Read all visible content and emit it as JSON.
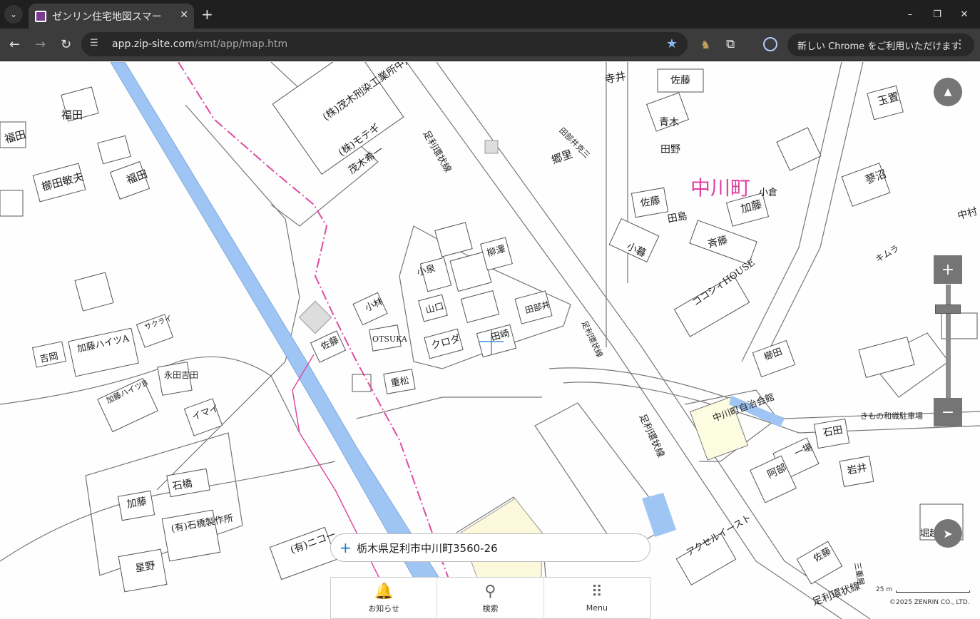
{
  "browser": {
    "tab_title": "ゼンリン住宅地図スマー",
    "url_host": "app.zip-site.com",
    "url_path": "/smt/app/map.htm",
    "update_chip": "新しい Chrome をご利用いただけます"
  },
  "map": {
    "town_name": "中川町",
    "labels": [
      {
        "name": "fukuda-1",
        "text": "福田"
      },
      {
        "name": "fukuda-2",
        "text": "福田"
      },
      {
        "name": "fukuda-3",
        "text": "福田"
      },
      {
        "name": "kushida-toshio",
        "text": "櫛田敏夫"
      },
      {
        "name": "mokita",
        "text": "(株)茂木刑染工業所中川工場"
      },
      {
        "name": "motegi",
        "text": "(株)モテギ"
      },
      {
        "name": "motegi-kiichi",
        "text": "茂木希一"
      },
      {
        "name": "ring-road-1",
        "text": "足利環状線"
      },
      {
        "name": "ring-road-2",
        "text": "足利環状線"
      },
      {
        "name": "ring-road-3",
        "text": "足利環状線"
      },
      {
        "name": "ring-road-4",
        "text": "足利環状線"
      },
      {
        "name": "terai",
        "text": "寺井"
      },
      {
        "name": "sato-1",
        "text": "佐藤"
      },
      {
        "name": "tamaoki",
        "text": "玉置"
      },
      {
        "name": "aoki",
        "text": "青木"
      },
      {
        "name": "tano",
        "text": "田野"
      },
      {
        "name": "tabei-katsumi",
        "text": "田部井克三"
      },
      {
        "name": "gori",
        "text": "郷里"
      },
      {
        "name": "kuranuma",
        "text": "蓼沼"
      },
      {
        "name": "oguraya",
        "text": "小倉"
      },
      {
        "name": "kato-1",
        "text": "加藤"
      },
      {
        "name": "sato-2",
        "text": "佐藤"
      },
      {
        "name": "tashima",
        "text": "田島"
      },
      {
        "name": "saito",
        "text": "斉藤"
      },
      {
        "name": "nakamura",
        "text": "中村"
      },
      {
        "name": "kogure",
        "text": "小暮"
      },
      {
        "name": "yanagisawa",
        "text": "柳澤"
      },
      {
        "name": "koizumi",
        "text": "小泉"
      },
      {
        "name": "kobayashi",
        "text": "小林"
      },
      {
        "name": "yamaguchi",
        "text": "山口"
      },
      {
        "name": "tabei",
        "text": "田部井"
      },
      {
        "name": "kimura",
        "text": "キムラ"
      },
      {
        "name": "kokoshii-house",
        "text": "ココシィHOUSE"
      },
      {
        "name": "kuroda",
        "text": "クロダ"
      },
      {
        "name": "tasaki",
        "text": "田崎"
      },
      {
        "name": "otsuka",
        "text": "OTSUKA"
      },
      {
        "name": "sato-3",
        "text": "佐藤"
      },
      {
        "name": "shigematsu",
        "text": "重松"
      },
      {
        "name": "yoshioka",
        "text": "吉岡"
      },
      {
        "name": "kato-heights-a",
        "text": "加藤ハイツA"
      },
      {
        "name": "kato-heights-b",
        "text": "加藤ハイツB"
      },
      {
        "name": "sakurai",
        "text": "サクライ"
      },
      {
        "name": "nagata-yoshida",
        "text": "永田吉田"
      },
      {
        "name": "imai",
        "text": "イマイ"
      },
      {
        "name": "kushida",
        "text": "櫛田"
      },
      {
        "name": "ishibashi",
        "text": "石橋"
      },
      {
        "name": "kato-2",
        "text": "加藤"
      },
      {
        "name": "ishibashi-seisakusho",
        "text": "(有)石橋製作所"
      },
      {
        "name": "hoshino",
        "text": "星野"
      },
      {
        "name": "nikko",
        "text": "(有)ニコー"
      },
      {
        "name": "nakagawa-hall",
        "text": "中川町自治会館"
      },
      {
        "name": "kimono-parking",
        "text": "きもの和織駐車場"
      },
      {
        "name": "ishida",
        "text": "石田"
      },
      {
        "name": "abe",
        "text": "阿部"
      },
      {
        "name": "ichiba",
        "text": "一場"
      },
      {
        "name": "iwai",
        "text": "岩井"
      },
      {
        "name": "sato-4",
        "text": "佐藤"
      },
      {
        "name": "accel-east",
        "text": "アクセルイースト"
      },
      {
        "name": "horikoshi",
        "text": "堀越"
      },
      {
        "name": "mitsuhashi",
        "text": "三重屋"
      }
    ]
  },
  "controls": {
    "compass_icon": "compass-icon",
    "zoom_in": "+",
    "zoom_out": "−",
    "zoom_level": 0.22
  },
  "address": {
    "text": "栃木県足利市中川町3560-26"
  },
  "bottom_menu": [
    {
      "label": "お知らせ"
    },
    {
      "label": "検索"
    },
    {
      "label": "Menu"
    }
  ],
  "scale_label": "25 m",
  "copyright": "©2025 ZENRIN CO., LTD."
}
